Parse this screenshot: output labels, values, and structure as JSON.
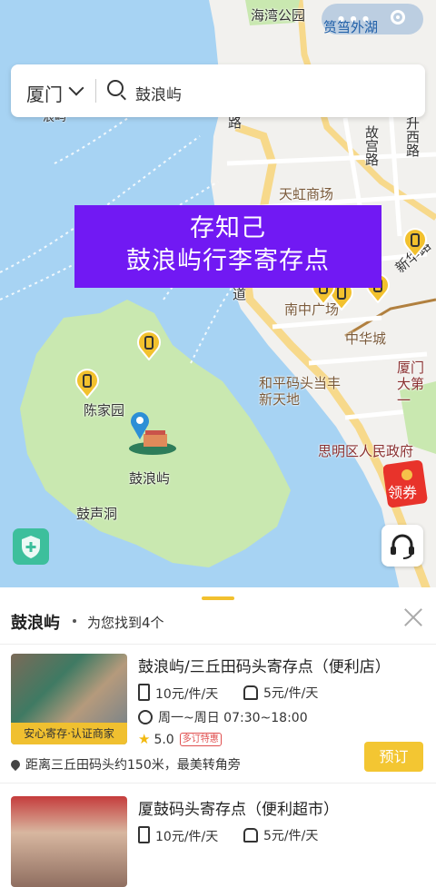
{
  "map": {
    "labels": {
      "park": "海湾公园",
      "guyu": "故宫路",
      "tianhong": "天虹商场",
      "jiangxi": "升西路",
      "xinhua": "新华路",
      "nanzhong": "南中广场",
      "zhonghua": "中华城",
      "xiamenda": "厦门大第一",
      "heping": "和平码头当丰新天地",
      "siming": "思明区人民政府",
      "chenjia": "陈家园",
      "gulangyu": "鼓浪屿",
      "gusheng": "鼓声洞",
      "lu_small": "路",
      "dao_small": "道",
      "lang_small": "浪屿"
    },
    "top_chip": "筼筜外湖",
    "colors": {
      "water": "#a7d3f3",
      "island": "#c9e8b0",
      "land": "#f2f1ee",
      "road": "#ffffff",
      "major_road": "#f7d98b",
      "pin": "#f2c12e"
    }
  },
  "search": {
    "city": "厦门",
    "query": "鼓浪屿",
    "icons": [
      "chevron-down-icon",
      "search-icon"
    ]
  },
  "banner": {
    "line1": "存知己",
    "line2": "鼓浪屿行李寄存点"
  },
  "coupon": {
    "label": "领券"
  },
  "sheet": {
    "title": "鼓浪屿",
    "count_text": "为您找到4个",
    "results": [
      {
        "name": "鼓浪屿/三丘田码头寄存点（便利店）",
        "badge": "安心寄存·认证商家",
        "price_large": "10元/件/天",
        "price_small": "5元/件/天",
        "hours": "周一~周日 07:30~18:00",
        "rating": "5.0",
        "tag": "多订特惠",
        "distance": "距离三丘田码头约150米，最美转角旁",
        "button": "预订"
      },
      {
        "name": "厦鼓码头寄存点（便利超市）",
        "price_large": "10元/件/天",
        "price_small": "5元/件/天"
      }
    ]
  }
}
